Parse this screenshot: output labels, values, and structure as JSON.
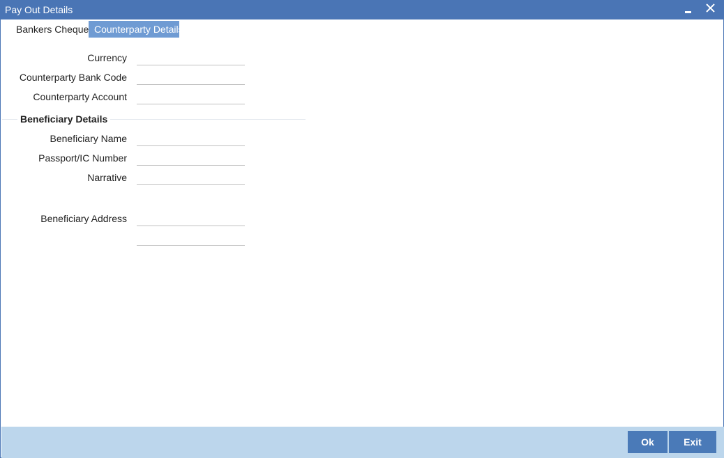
{
  "window": {
    "title": "Pay Out Details"
  },
  "tabs": [
    {
      "label": "Bankers Cheque",
      "active": false
    },
    {
      "label": "Counterparty Details",
      "active": true
    }
  ],
  "form": {
    "currency_label": "Currency",
    "currency_value": "",
    "bank_code_label": "Counterparty Bank Code",
    "bank_code_value": "",
    "account_label": "Counterparty Account",
    "account_value": ""
  },
  "beneficiary": {
    "section_title": "Beneficiary Details",
    "name_label": "Beneficiary Name",
    "name_value": "",
    "passport_label": "Passport/IC Number",
    "passport_value": "",
    "narrative_label": "Narrative",
    "narrative_value": "",
    "address_label": "Beneficiary Address",
    "address_line1": "",
    "address_line2": ""
  },
  "footer": {
    "ok_label": "Ok",
    "exit_label": "Exit"
  },
  "colors": {
    "titlebar": "#4a75b5",
    "active_tab": "#6f9bd3",
    "footer": "#bcd6ec",
    "button": "#4a7ab8"
  }
}
